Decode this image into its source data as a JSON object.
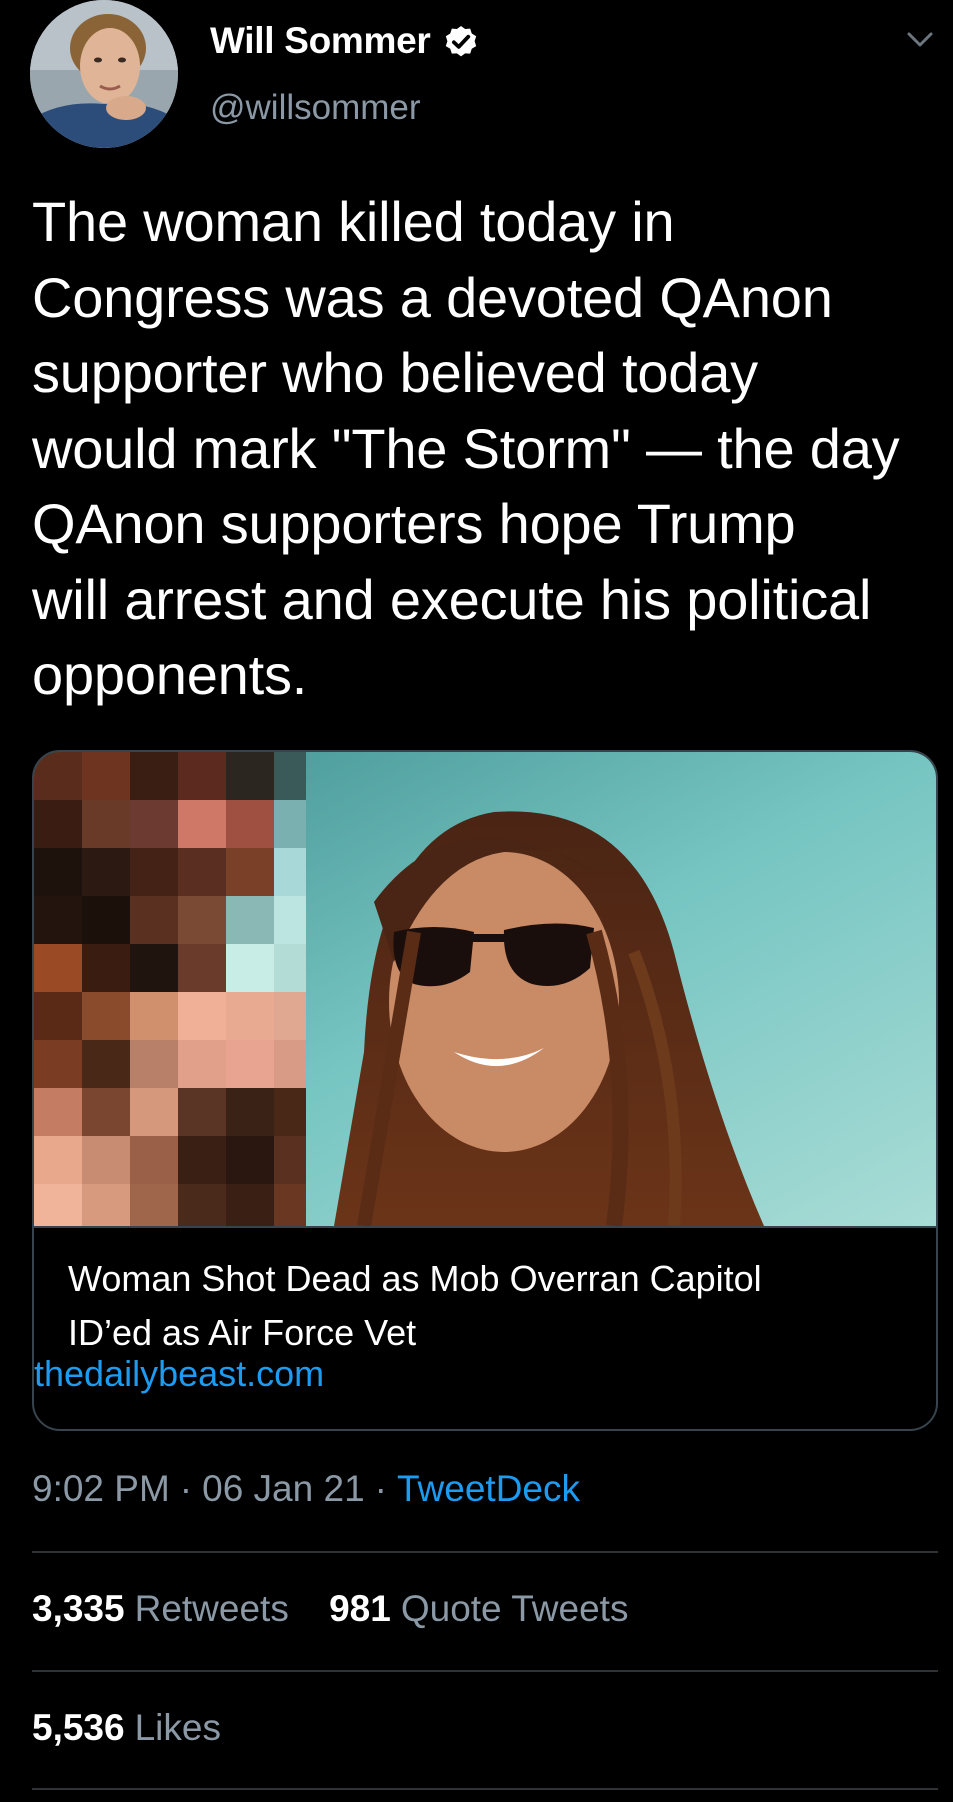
{
  "author": {
    "display_name": "Will Sommer",
    "handle": "@willsommer",
    "verified": true,
    "avatar_icon": "profile-photo",
    "menu_icon": "chevron-down-icon"
  },
  "tweet": {
    "text_lines": [
      "The woman killed today in",
      "Congress was a devoted QAnon",
      "supporter who believed today",
      "would mark \"The Storm\" — the day",
      "QAnon supporters hope Trump",
      "will arrest and execute his political",
      "opponents."
    ]
  },
  "link_card": {
    "image_description_icon": "article-photo",
    "title_lines": [
      "Woman Shot Dead as Mob Overran Capitol",
      "ID’ed as Air Force Vet"
    ],
    "domain": "thedailybeast.com"
  },
  "meta": {
    "time": "9:02 PM",
    "separator": "·",
    "date": "06 Jan 21",
    "source": "TweetDeck"
  },
  "stats": {
    "retweets_count": "3,335",
    "retweets_label": "Retweets",
    "quotes_count": "981",
    "quotes_label": "Quote Tweets",
    "likes_count": "5,536",
    "likes_label": "Likes"
  },
  "colors": {
    "background": "#000000",
    "text_primary": "#ffffff",
    "text_secondary": "#8b98a5",
    "link": "#1d9bf0",
    "border": "#38444d",
    "divider": "#2f3336"
  }
}
